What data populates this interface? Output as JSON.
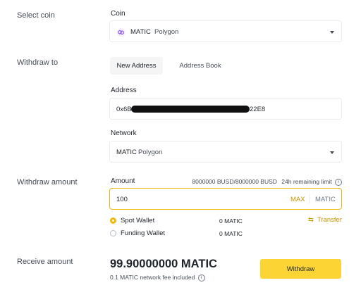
{
  "sections": {
    "select_coin": "Select coin",
    "withdraw_to": "Withdraw to",
    "withdraw_amount": "Withdraw amount",
    "receive_amount": "Receive amount"
  },
  "coin": {
    "label": "Coin",
    "symbol": "MATIC",
    "name": "Polygon",
    "icon": "polygon-logo-icon"
  },
  "tabs": [
    {
      "label": "New Address",
      "active": true
    },
    {
      "label": "Address Book",
      "active": false
    }
  ],
  "address": {
    "label": "Address",
    "prefix": "0x6B",
    "suffix": "22E8"
  },
  "network": {
    "label": "Network",
    "symbol": "MATIC",
    "name": "Polygon"
  },
  "amount": {
    "label": "Amount",
    "limit": "8000000 BUSD/8000000 BUSD",
    "remaining": "24h remaining limit",
    "value": "100",
    "max_label": "MAX",
    "unit": "MATIC"
  },
  "wallets": [
    {
      "label": "Spot Wallet",
      "balance": "0 MATIC",
      "selected": true
    },
    {
      "label": "Funding Wallet",
      "balance": "0 MATIC",
      "selected": false
    }
  ],
  "transfer_label": "Transfer",
  "receive": {
    "value": "99.90000000 MATIC",
    "fee_note": "0.1 MATIC network fee included"
  },
  "withdraw_button": "Withdraw",
  "colors": {
    "accent": "#f0b90b",
    "link": "#c99400",
    "border": "#eaecef"
  }
}
